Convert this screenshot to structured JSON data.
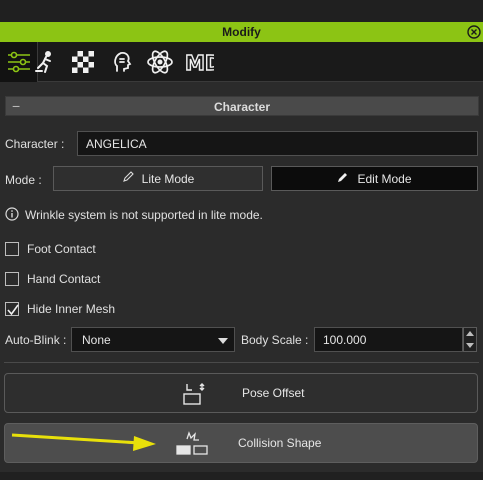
{
  "window": {
    "title": "Modify"
  },
  "toolbar": {
    "tools": [
      "sliders-icon",
      "motion-icon",
      "checker-icon",
      "head-icon",
      "atom-icon",
      "md-icon"
    ],
    "md_label": "MD"
  },
  "section": {
    "title": "Character",
    "collapse_symbol": "−"
  },
  "character": {
    "label": "Character :",
    "value": "ANGELICA"
  },
  "mode": {
    "label": "Mode :",
    "lite_label": "Lite Mode",
    "edit_label": "Edit Mode"
  },
  "info": {
    "text": "Wrinkle system is not supported in lite mode."
  },
  "options": {
    "foot_contact": {
      "label": "Foot Contact",
      "checked": false
    },
    "hand_contact": {
      "label": "Hand Contact",
      "checked": false
    },
    "hide_inner_mesh": {
      "label": "Hide Inner Mesh",
      "checked": true
    }
  },
  "autoblink": {
    "label": "Auto-Blink :",
    "value": "None"
  },
  "body_scale": {
    "label": "Body Scale :",
    "value": "100.000"
  },
  "buttons": {
    "pose_offset": "Pose Offset",
    "collision_shape": "Collision Shape"
  },
  "colors": {
    "accent": "#8cc414",
    "arrow": "#e8e00a",
    "panel": "#2b2b2b"
  }
}
